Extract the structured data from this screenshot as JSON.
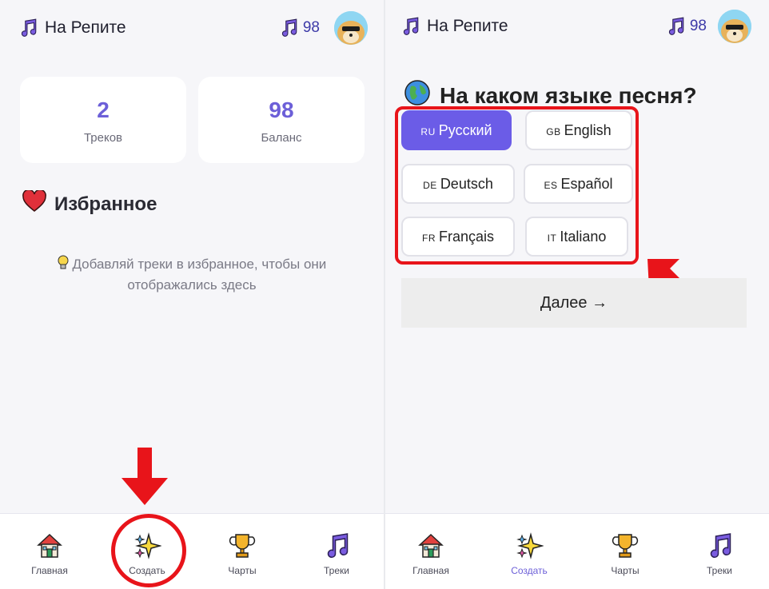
{
  "app": {
    "title": "На Репите",
    "balance": "98"
  },
  "home": {
    "stats": [
      {
        "value": "2",
        "label": "Треков"
      },
      {
        "value": "98",
        "label": "Баланс"
      }
    ],
    "favorites_title": "Избранное",
    "empty_hint": "Добавляй треки в избранное, чтобы они отображались здесь"
  },
  "create": {
    "question": "На каком языке песня?",
    "languages": [
      {
        "code": "RU",
        "name": "Русский",
        "selected": true
      },
      {
        "code": "GB",
        "name": "English",
        "selected": false
      },
      {
        "code": "DE",
        "name": "Deutsch",
        "selected": false
      },
      {
        "code": "ES",
        "name": "Español",
        "selected": false
      },
      {
        "code": "FR",
        "name": "Français",
        "selected": false
      },
      {
        "code": "IT",
        "name": "Italiano",
        "selected": false
      }
    ],
    "next_label": "Далее →"
  },
  "nav": {
    "items": [
      {
        "label": "Главная",
        "icon": "house-icon"
      },
      {
        "label": "Создать",
        "icon": "sparkles-icon"
      },
      {
        "label": "Чарты",
        "icon": "trophy-icon"
      },
      {
        "label": "Треки",
        "icon": "music-note-icon"
      }
    ]
  },
  "colors": {
    "accent": "#6b5ce7",
    "annotation": "#e8141a"
  }
}
